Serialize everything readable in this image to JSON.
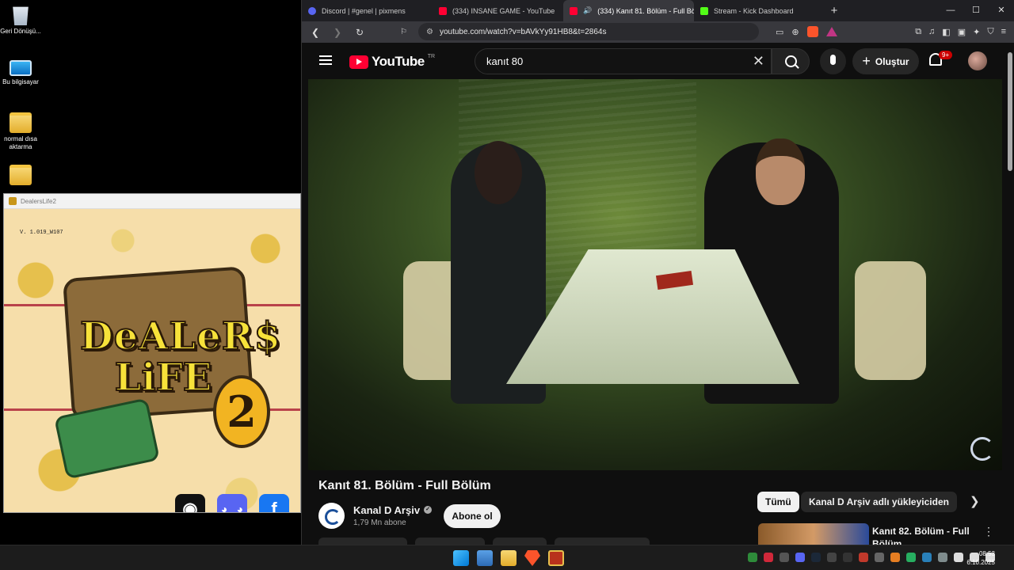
{
  "desktop": {
    "icons": [
      {
        "label": "Geri Dönüşü..."
      },
      {
        "label": "Bu bilgisayar"
      },
      {
        "label": "normal dısa aktarma"
      },
      {
        "label": ""
      }
    ]
  },
  "game_window": {
    "title": "DealersLife2",
    "version": "V. 1.019_W107",
    "logo_line1": "DeALeR$",
    "logo_line2": "LiFE",
    "logo_number": "2"
  },
  "browser": {
    "tabs": [
      {
        "label": "Discord | #genel | pixmens",
        "icon": "discord-icon"
      },
      {
        "label": "(334) INSANE GAME - YouTube",
        "icon": "youtube-icon"
      },
      {
        "label": "(334) Kanıt 81. Bölüm - Full Bö",
        "icon": "youtube-icon",
        "active": true
      },
      {
        "label": "Stream - Kick Dashboard",
        "icon": "kick-icon"
      }
    ],
    "url": "youtube.com/watch?v=bAVkYy91HB8&t=2864s"
  },
  "youtube": {
    "logo_text": "YouTube",
    "country": "TR",
    "search_query": "kanıt 80",
    "create_label": "Oluştur",
    "notification_count": "9+",
    "video_title": "Kanıt 81. Bölüm - Full Bölüm",
    "channel_name": "Kanal D Arşiv",
    "subscribers": "1,79 Mn abone",
    "subscribe_label": "Abone ol",
    "chips": [
      "Tümü",
      "Kanal D Arşiv adlı yükleyiciden"
    ],
    "recommendation_title": "Kanıt 82. Bölüm - Full Bölüm"
  },
  "taskbar": {
    "time": "08:53",
    "date": "6.10.2025"
  },
  "colors": {
    "youtube_red": "#ff0033",
    "discord": "#5865f2",
    "kick": "#53fc18",
    "brave": "#fb542b"
  }
}
